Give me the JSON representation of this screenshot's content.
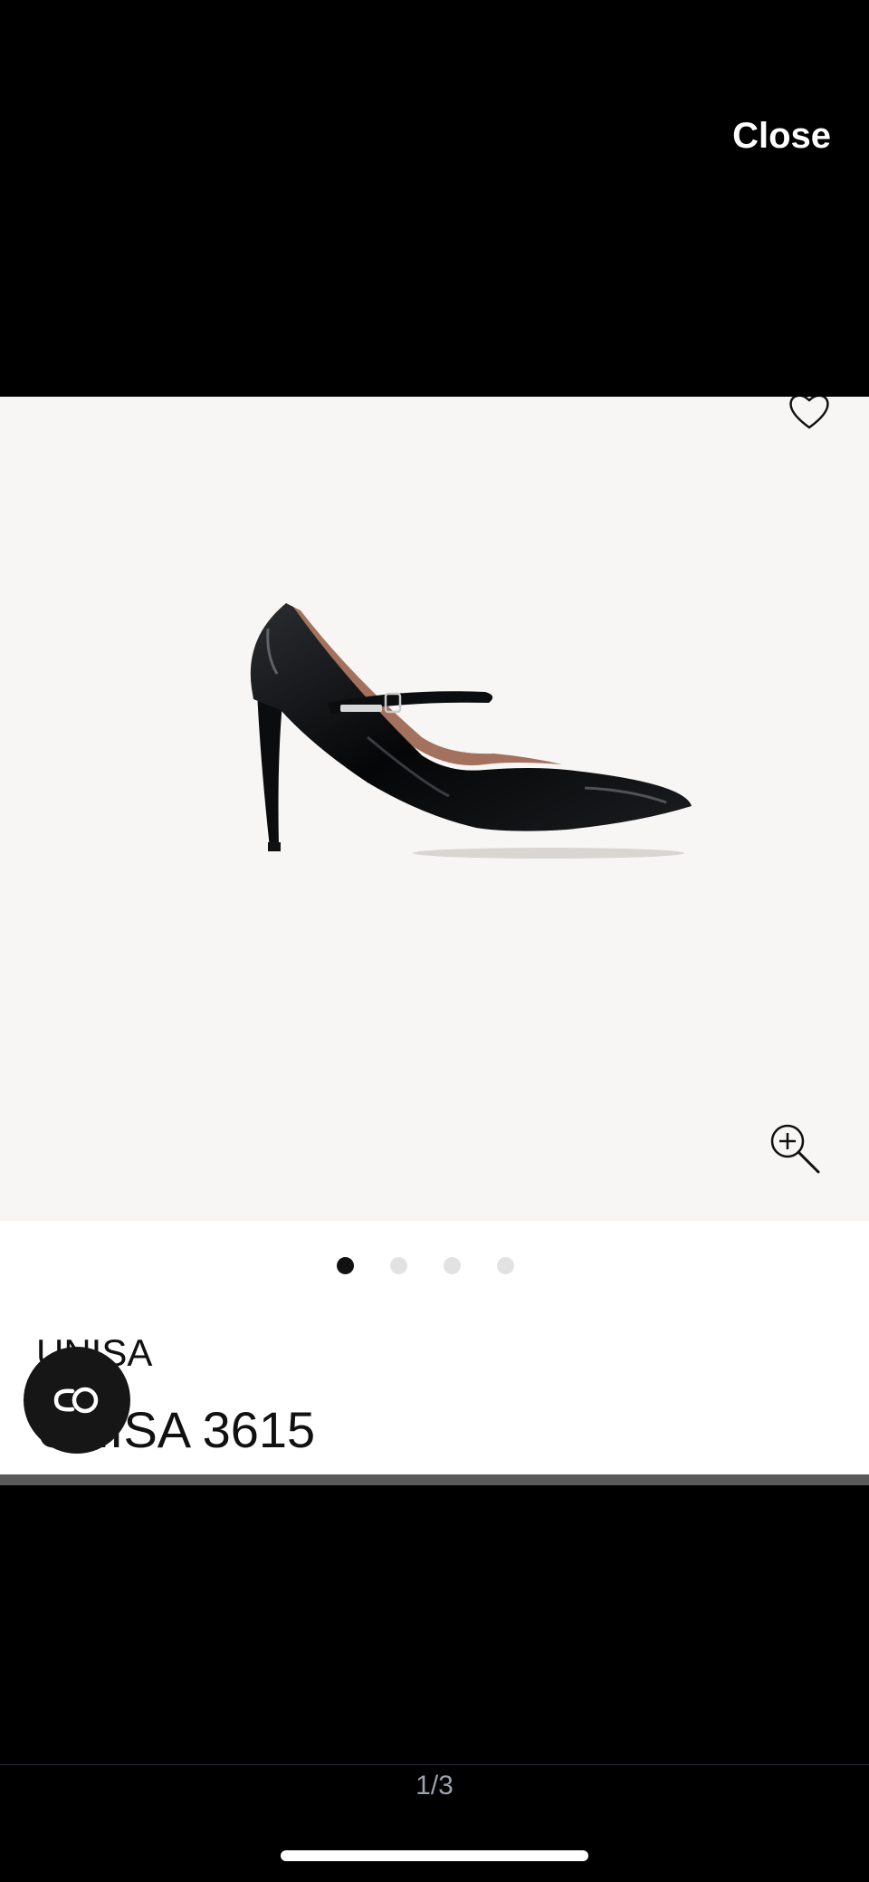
{
  "header": {
    "close_label": "Close"
  },
  "product": {
    "brand": "UNISA",
    "name": "UNISA 3615"
  },
  "gallery": {
    "dots_total": 4,
    "active_dot": 1
  },
  "viewer": {
    "page_indicator": "1/3"
  },
  "icons": {
    "favorite": "heart-icon",
    "zoom": "zoom-in-icon",
    "chat": "chat-link-icon"
  },
  "colors": {
    "background": "#000000",
    "image_bg": "#f7f6f4",
    "accent": "#111111"
  }
}
